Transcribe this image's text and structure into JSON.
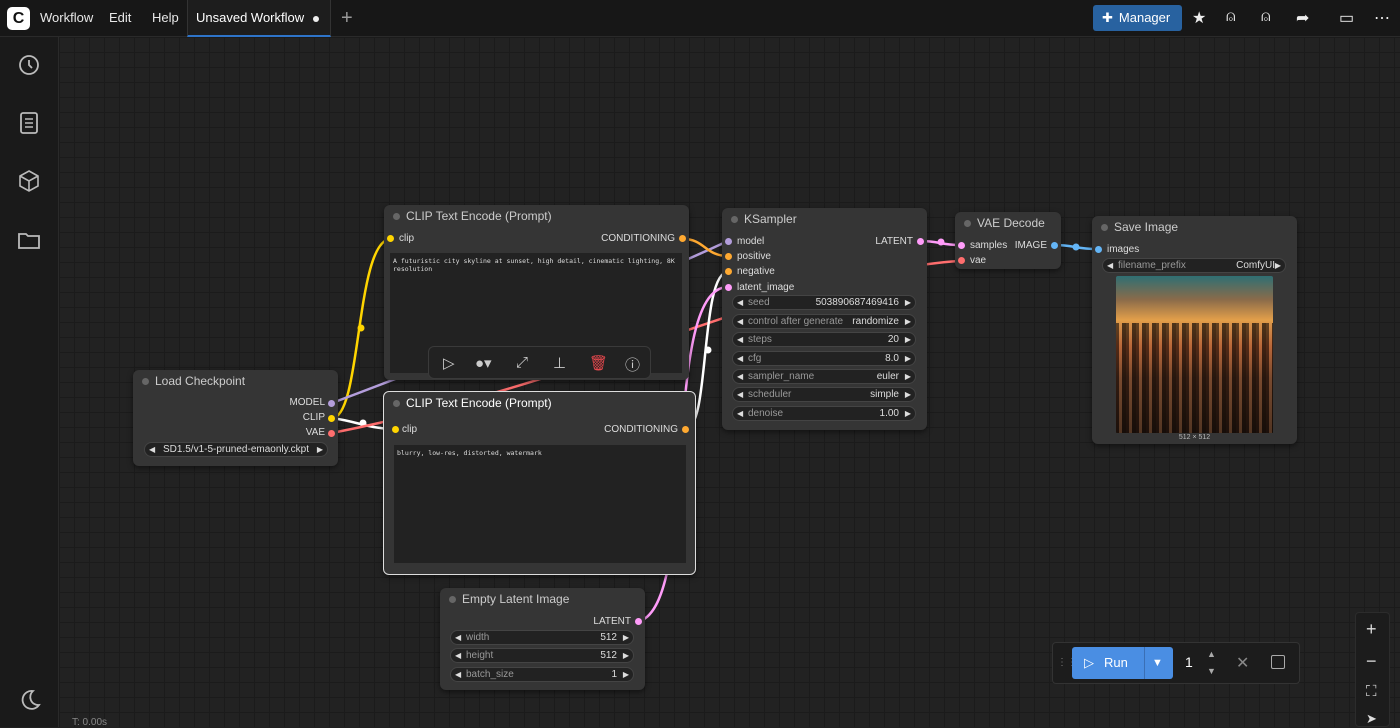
{
  "topbar": {
    "logo": "C",
    "menu": [
      "Workflow",
      "Edit",
      "Help"
    ],
    "tab_title": "Unsaved Workflow",
    "new_tab": "+",
    "manager_label": "Manager",
    "icons": [
      "puzzle-icon",
      "star-icon",
      "user-avatar-icon",
      "user-avatar-icon",
      "share-icon",
      "panel-icon",
      "more-icon"
    ]
  },
  "sidebar": {
    "icons": [
      "history-icon",
      "document-icon",
      "cube-icon",
      "folder-icon",
      "moon-icon"
    ]
  },
  "nodes": {
    "load_checkpoint": {
      "title": "Load Checkpoint",
      "outputs": [
        "MODEL",
        "CLIP",
        "VAE"
      ],
      "ckpt": "SD1.5/v1-5-pruned-emaonly.ckpt"
    },
    "clip_pos": {
      "title": "CLIP Text Encode (Prompt)",
      "input": "clip",
      "output": "CONDITIONING",
      "text": "A futuristic city skyline at sunset, high detail, cinematic lighting, 8K resolution"
    },
    "clip_neg": {
      "title": "CLIP Text Encode (Prompt)",
      "input": "clip",
      "output": "CONDITIONING",
      "text": "blurry, low-res, distorted, watermark"
    },
    "ksampler": {
      "title": "KSampler",
      "inputs": [
        "model",
        "positive",
        "negative",
        "latent_image"
      ],
      "output": "LATENT",
      "widgets": [
        {
          "label": "seed",
          "value": "503890687469416"
        },
        {
          "label": "control after generate",
          "value": "randomize"
        },
        {
          "label": "steps",
          "value": "20"
        },
        {
          "label": "cfg",
          "value": "8.0"
        },
        {
          "label": "sampler_name",
          "value": "euler"
        },
        {
          "label": "scheduler",
          "value": "simple"
        },
        {
          "label": "denoise",
          "value": "1.00"
        }
      ]
    },
    "vae_decode": {
      "title": "VAE Decode",
      "inputs": [
        "samples",
        "vae"
      ],
      "output": "IMAGE"
    },
    "save_image": {
      "title": "Save Image",
      "input": "images",
      "filename_label": "filename_prefix",
      "filename_value": "ComfyUI",
      "size_caption": "512 × 512"
    },
    "empty_latent": {
      "title": "Empty Latent Image",
      "output": "LATENT",
      "widgets": [
        {
          "label": "width",
          "value": "512"
        },
        {
          "label": "height",
          "value": "512"
        },
        {
          "label": "batch_size",
          "value": "1"
        }
      ]
    }
  },
  "runbar": {
    "run_label": "Run",
    "count": "1"
  },
  "status": {
    "timer": "T: 0.00s"
  },
  "colors": {
    "accent": "#2862a0",
    "run": "#4a8ee3",
    "clip_wire": "#ffd500",
    "model_wire": "#b39ddb",
    "vae_wire": "#ff6e6e",
    "latent_wire": "#ff9cf9",
    "image_wire": "#64b5f6",
    "cond_wire": "#ffa931"
  }
}
